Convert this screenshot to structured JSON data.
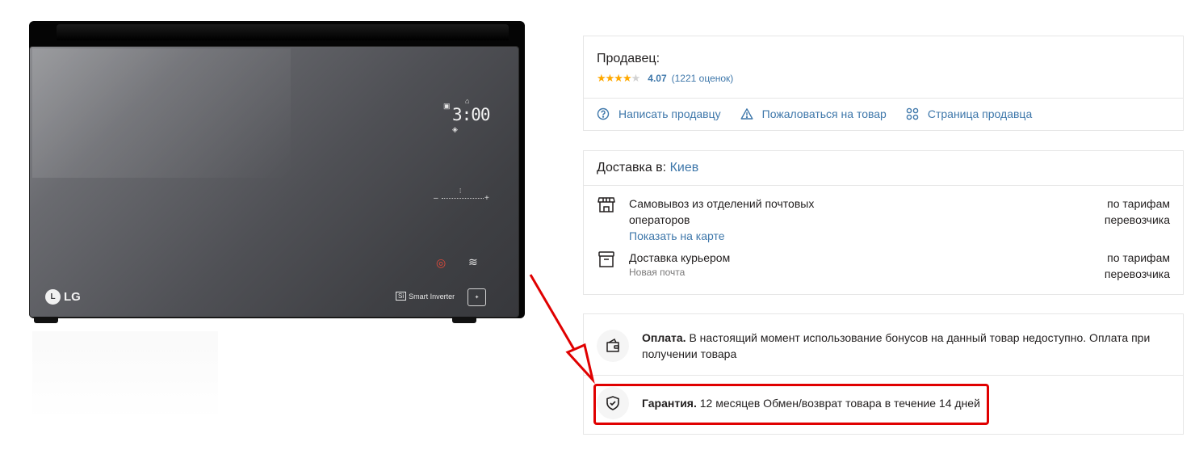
{
  "product": {
    "display_time": "3:00",
    "brand": "LG",
    "brand_mark": "L",
    "inverter_badge": "Si",
    "inverter_label": "Smart Inverter"
  },
  "seller": {
    "title": "Продавец:",
    "rating_value": "4.07",
    "rating_count": "(1221 оценок)",
    "stars_filled": 4,
    "stars_total": 5,
    "links": {
      "write": "Написать продавцу",
      "complain": "Пожаловаться на товар",
      "page": "Страница продавца"
    }
  },
  "delivery": {
    "title_prefix": "Доставка в:",
    "city": "Киев",
    "pickup": {
      "title": "Самовывоз из отделений почтовых операторов",
      "link": "Показать на карте",
      "price": "по тарифам перевозчика"
    },
    "courier": {
      "title": "Доставка курьером",
      "sub": "Новая почта",
      "price": "по тарифам перевозчика"
    }
  },
  "payment": {
    "label": "Оплата.",
    "text": "В настоящий момент использование бонусов на данный товар недоступно. Оплата при получении товара"
  },
  "warranty": {
    "label": "Гарантия.",
    "text": "12 месяцев Обмен/возврат товара в течение 14 дней"
  },
  "colors": {
    "link": "#3e77aa",
    "star": "#ffa900",
    "highlight": "#e00000",
    "border": "#e6e6e6"
  }
}
